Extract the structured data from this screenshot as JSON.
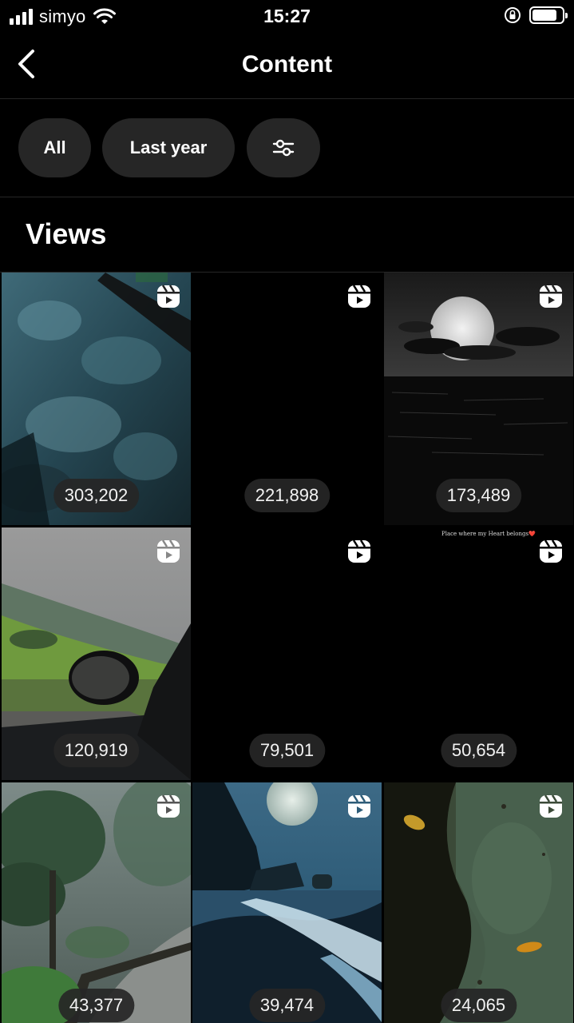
{
  "status_bar": {
    "carrier": "simyo",
    "time": "15:27"
  },
  "header": {
    "title": "Content",
    "back_icon": "chevron-left-icon"
  },
  "filters": {
    "chips": [
      {
        "label": "All"
      },
      {
        "label": "Last year"
      },
      {
        "label": "",
        "icon": "sliders-icon"
      }
    ]
  },
  "section": {
    "title": "Views"
  },
  "grid": {
    "items": [
      {
        "views": "303,202",
        "icon": "reel-icon"
      },
      {
        "views": "221,898",
        "icon": "reel-icon"
      },
      {
        "views": "173,489",
        "icon": "reel-icon"
      },
      {
        "views": "120,919",
        "icon": "reel-icon"
      },
      {
        "views": "79,501",
        "icon": "reel-icon"
      },
      {
        "views": "50,654",
        "icon": "reel-icon",
        "overlay_text": "Place where my Heart belongs❤️"
      },
      {
        "views": "43,377",
        "icon": "reel-icon"
      },
      {
        "views": "39,474",
        "icon": "reel-icon"
      },
      {
        "views": "24,065",
        "icon": "reel-icon"
      }
    ]
  }
}
